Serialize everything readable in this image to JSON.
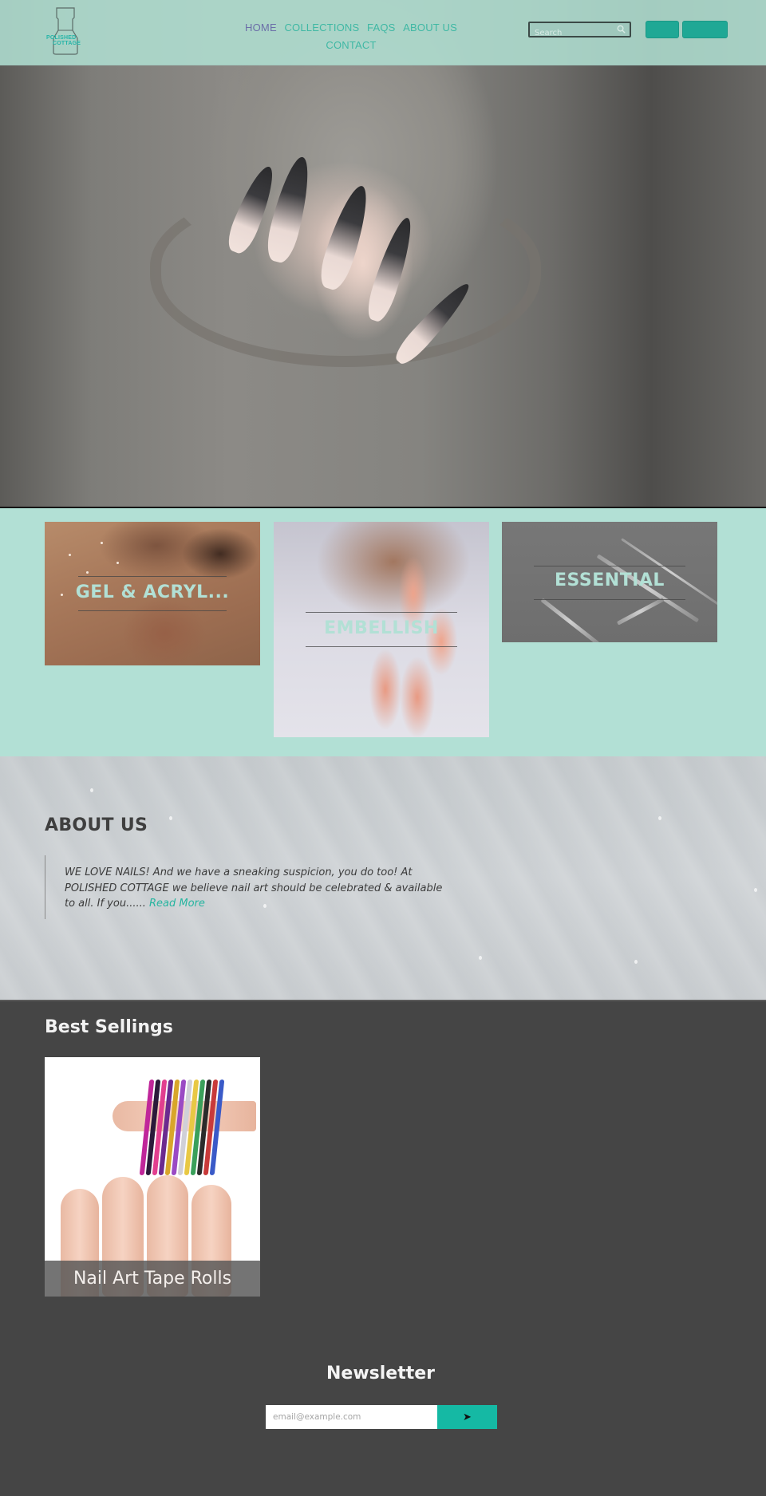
{
  "brand": {
    "name_line1": "POLISHED",
    "name_line2": "COTTAGE",
    "accent_color": "#26b5a8"
  },
  "nav": {
    "items": [
      {
        "label": "HOME",
        "active": true
      },
      {
        "label": "COLLECTIONS",
        "active": false
      },
      {
        "label": "FAQS",
        "active": false
      },
      {
        "label": "ABOUT US",
        "active": false
      },
      {
        "label": "CONTACT",
        "active": false
      }
    ]
  },
  "search": {
    "placeholder": "Search",
    "value": "",
    "icon": "search-icon"
  },
  "header_buttons": [
    {
      "label": ""
    },
    {
      "label": ""
    }
  ],
  "collections": [
    {
      "label": "GEL & ACRYL..."
    },
    {
      "label": "EMBELLISH"
    },
    {
      "label": "ESSENTIAL"
    }
  ],
  "about": {
    "title": "ABOUT US",
    "body": "WE LOVE NAILS!  And we have a sneaking suspicion, you do too!  At POLISHED COTTAGE we believe nail art should be celebrated & available to all.  If you...... ",
    "read_more": "Read More"
  },
  "best_sellings": {
    "title": "Best Sellings",
    "products": [
      {
        "name": "Nail Art Tape Rolls"
      }
    ]
  },
  "newsletter": {
    "title": "Newsletter",
    "email_placeholder": "email@example.com",
    "email_value": "",
    "submit_icon": "arrow-right-icon",
    "submit_glyph": "➤"
  },
  "colors": {
    "mint": "#b2e0d5",
    "teal_button": "#15b9a4",
    "dark_bg": "#454545",
    "nav_active": "#6b6ea8",
    "nav_link": "#3fb8a4"
  }
}
